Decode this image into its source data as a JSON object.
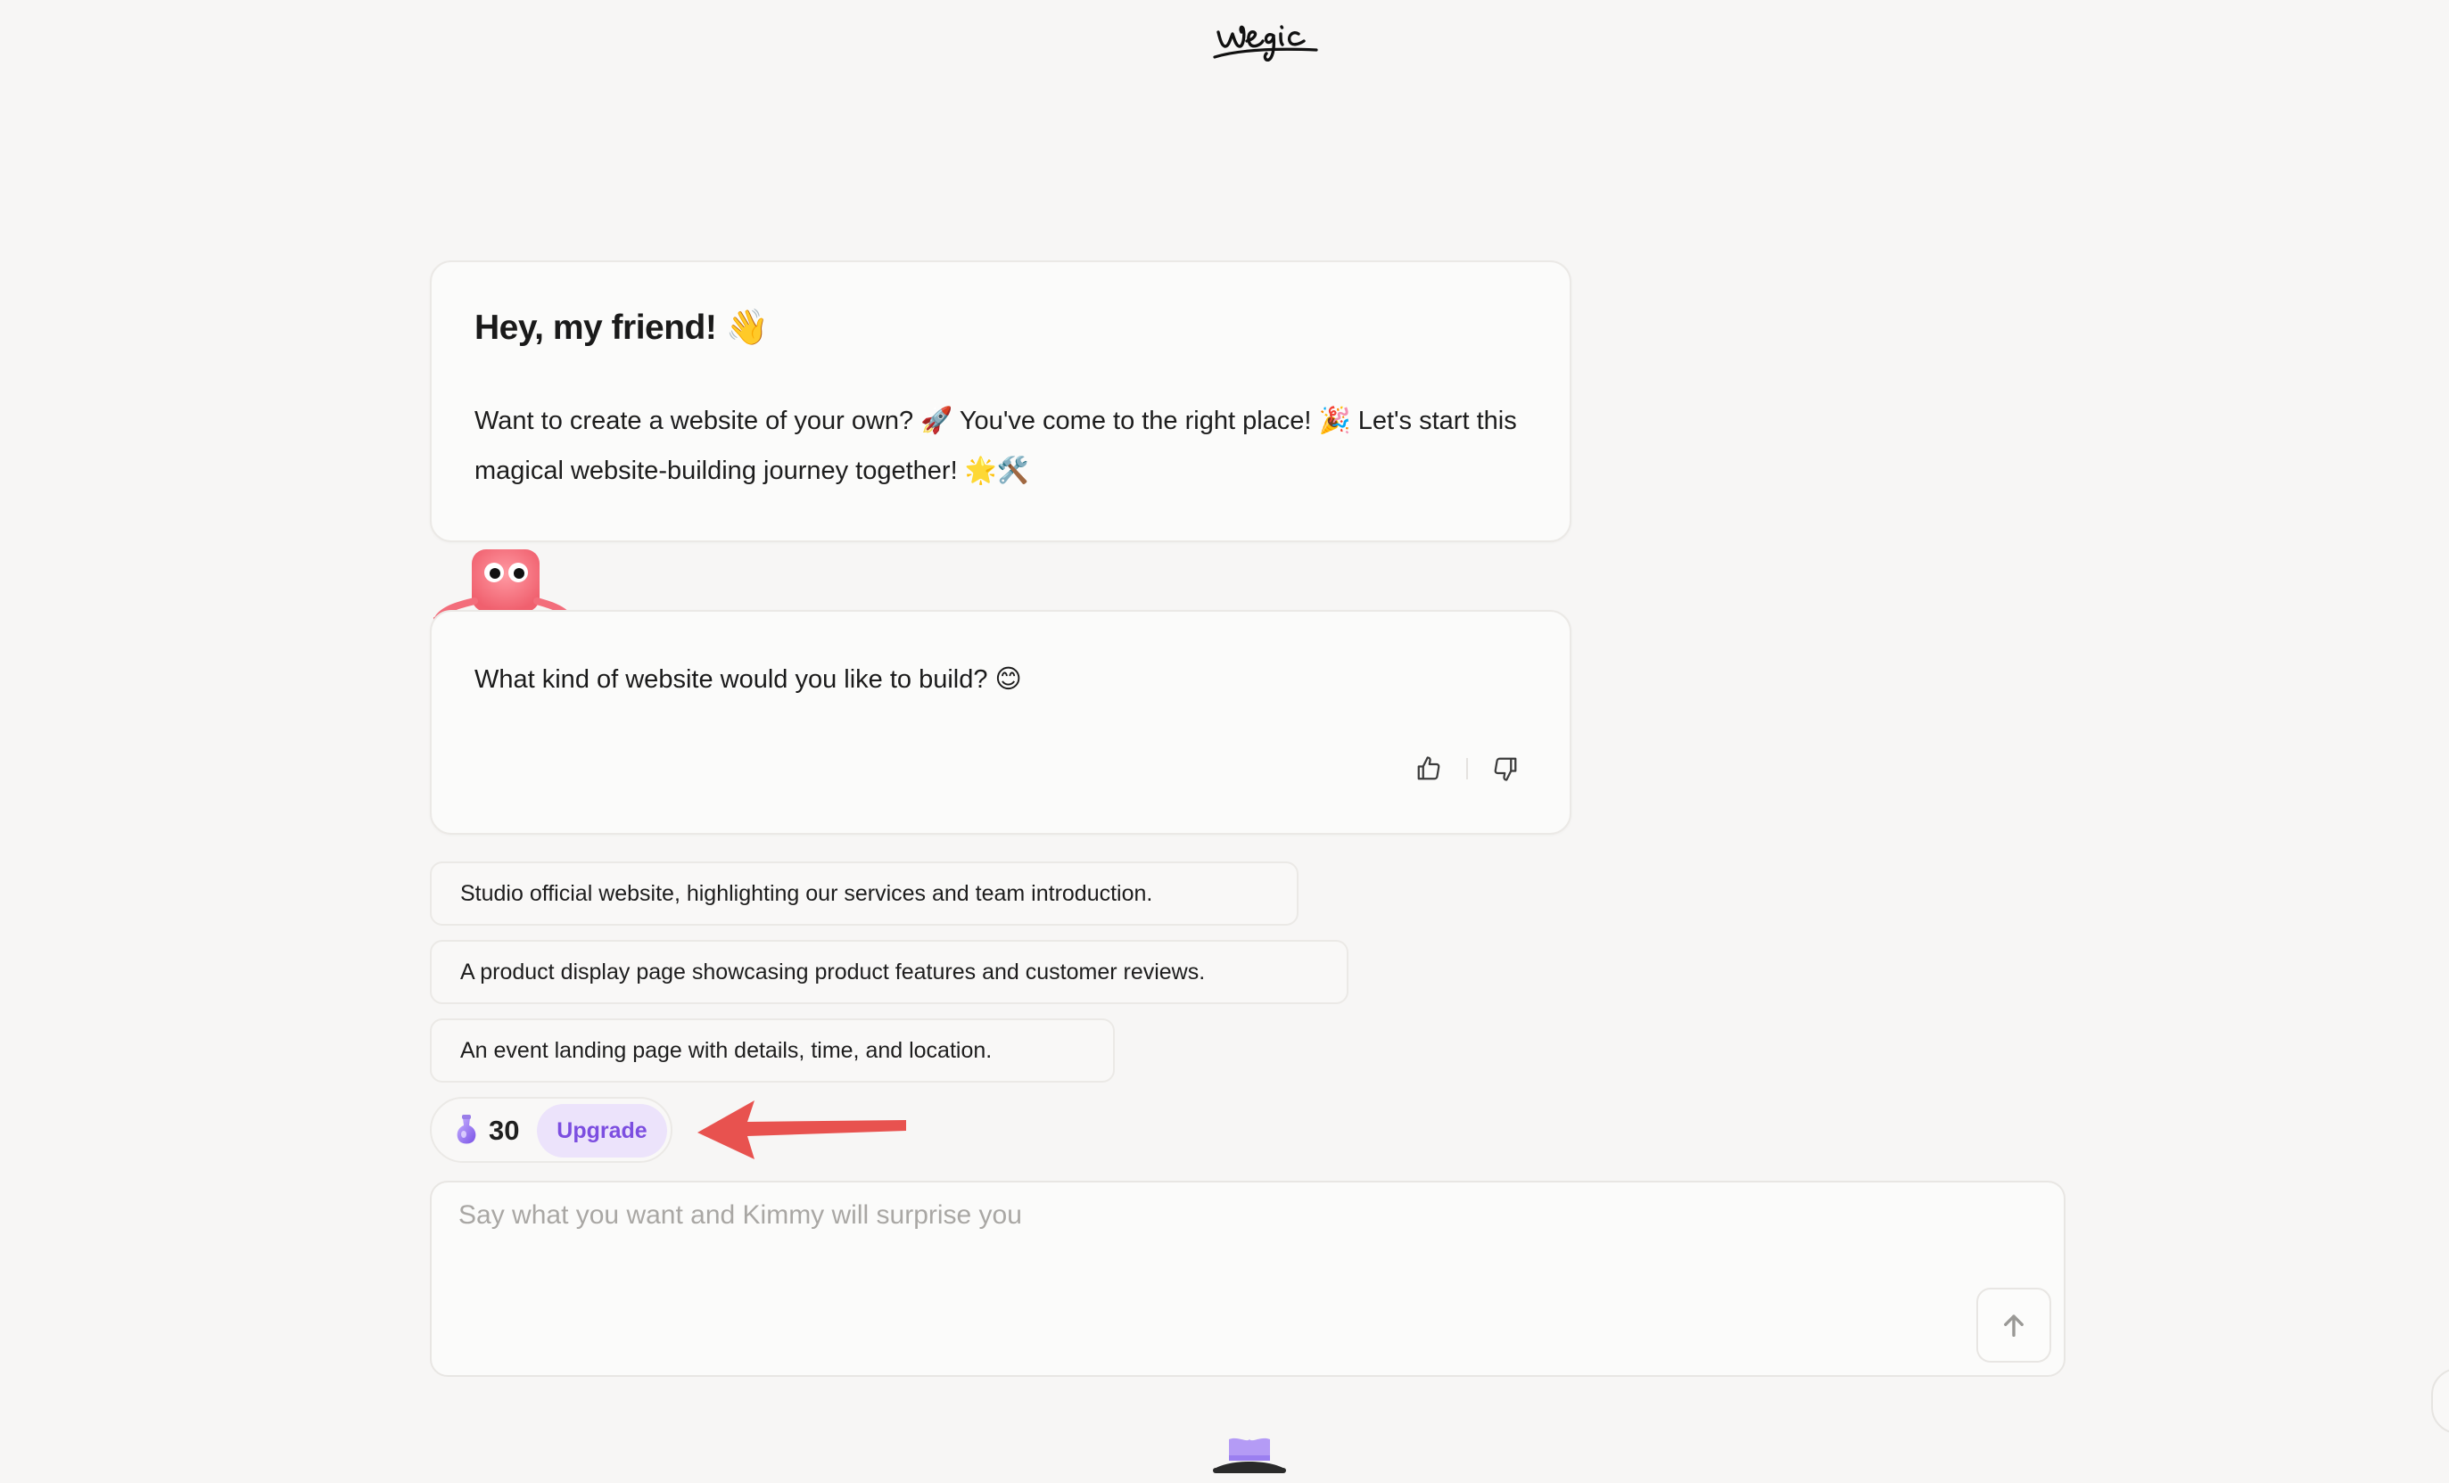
{
  "header": {
    "logo_text": "wegic",
    "logo_icon": "wegic-script-logo"
  },
  "greeting": {
    "title": "Hey, my friend! 👋",
    "body": "Want to create a website of your own? 🚀 You've come to the right place! 🎉 Let's start this magical website-building journey together! 🌟🛠️"
  },
  "mascot": {
    "icon": "kimmy-mascot-icon"
  },
  "question": {
    "text": "What kind of website would you like to build? 😊",
    "feedback": {
      "like_icon": "thumbs-up-icon",
      "dislike_icon": "thumbs-down-icon"
    }
  },
  "suggestions": [
    "Studio official website, highlighting our services and team introduction.",
    "A product display page showcasing product features and customer reviews.",
    "An event landing page with details, time, and location."
  ],
  "credits": {
    "icon": "potion-icon",
    "count": "30",
    "upgrade_label": "Upgrade"
  },
  "annotation": {
    "icon": "red-arrow-pointer",
    "color": "#e8524f"
  },
  "composer": {
    "placeholder": "Say what you want and Kimmy will surprise you",
    "value": "",
    "send_icon": "arrow-up-icon"
  },
  "footer": {
    "icon": "purple-hat-icon"
  },
  "colors": {
    "background": "#f7f6f5",
    "card": "#fbfbfa",
    "border": "#ebe9e6",
    "accent": "#7c4ee0",
    "accent_bg": "#ece3fb",
    "mascot_pink": "#f5737f",
    "arrow_red": "#e8524f"
  }
}
